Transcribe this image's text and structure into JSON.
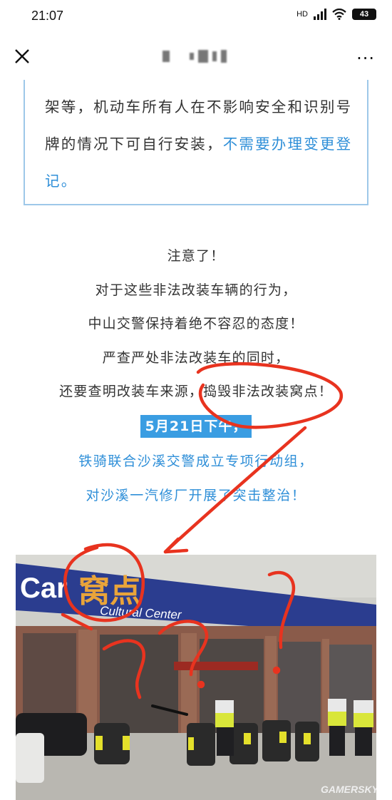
{
  "status_bar": {
    "time": "21:07",
    "network": "HD",
    "battery": "43"
  },
  "nav": {
    "close_icon": "close-icon",
    "more_icon": "more-icon",
    "more": "···"
  },
  "notice": {
    "text_normal": "架等，机动车所有人在不影响安全和识别号牌的情况下可自行安装，",
    "text_highlight": "不需要办理变更登记。"
  },
  "article": {
    "lines": [
      "注意了！",
      "对于这些非法改装车辆的行为，",
      "中山交警保持着绝不容忍的态度！",
      "严查严处非法改装车的同时，",
      "还要查明改装车来源，捣毁非法改装窝点！"
    ],
    "date_banner": "5月21日下午，",
    "blue_lines": [
      "铁骑联合沙溪交警成立专项行动组，",
      "对沙溪一汽修厂开展了突击整治！"
    ]
  },
  "photo": {
    "sign_car": "Car",
    "sign_chinese": "窝点",
    "sign_sub": "Cultural Center",
    "watermark": "GAMERSKY"
  },
  "colors": {
    "accent_blue": "#2f8fd8",
    "banner_blue": "#3a9de2",
    "annotation_red": "#e8331f",
    "sign_blue": "#2b3d8f"
  }
}
